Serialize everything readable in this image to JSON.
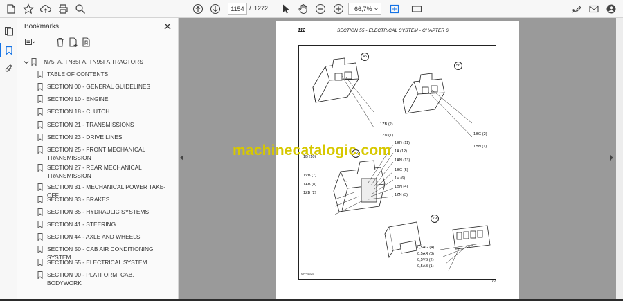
{
  "toolbar": {
    "current_page": "1154",
    "page_separator": "/",
    "total_pages": "1272",
    "zoom": "66,7%"
  },
  "panel": {
    "title": "Bookmarks"
  },
  "bookmarks": {
    "root": "TN75FA, TN85FA, TN95FA TRACTORS",
    "items": [
      "TABLE OF CONTENTS",
      "SECTION 00 - GENERAL GUIDELINES",
      "SECTION 10 - ENGINE",
      "SECTION 18 - CLUTCH",
      "SECTION 21 - TRANSMISSIONS",
      "SECTION 23 - DRIVE LINES",
      "SECTION 25 - FRONT MECHANICAL TRANSMISSION",
      "SECTION 27 - REAR MECHANICAL TRANSMISSION",
      "SECTION 31 - MECHANICAL POWER TAKE-OFF",
      "SECTION 33 - BRAKES",
      "SECTION 35 - HYDRAULIC SYSTEMS",
      "SECTION 41 - STEERING",
      "SECTION 44 - AXLE AND WHEELS",
      "SECTION 50 - CAB AIR CONDITIONING SYSTEM",
      "SECTION 55 - ELECTRICAL SYSTEM",
      "SECTION 90 - PLATFORM, CAB, BODYWORK"
    ]
  },
  "document": {
    "page_number": "112",
    "section_header": "SECTION 55 - ELECTRICAL SYSTEM - CHAPTER 6",
    "footer_number": "72",
    "figure_code": "MPP01024",
    "watermark": "machinecatalogic.com",
    "connectors": [
      {
        "ref": "45",
        "wires": [
          "1ZB (2)",
          "1ZN (1)"
        ]
      },
      {
        "ref": "56",
        "wires": [
          "1BG (2)",
          "1BN (1)"
        ]
      },
      {
        "ref": "72",
        "wires_left": [
          "1B (10)",
          "1VB (7)",
          "1AB (8)",
          "1ZB (2)"
        ],
        "wires_right": [
          "1BR (11)",
          "1A (12)",
          "1AN (13)",
          "1BG (5)",
          "1V (6)",
          "1BN (4)",
          "1ZN (3)"
        ]
      },
      {
        "ref": "79",
        "wires": [
          "0,5AG (4)",
          "0,5AR (3)",
          "0,5VB (2)",
          "0,5AB (1)"
        ]
      }
    ]
  },
  "colors": {
    "accent": "#1473e6",
    "watermark": "#d7c800",
    "doc_background": "#9a9a9a"
  }
}
